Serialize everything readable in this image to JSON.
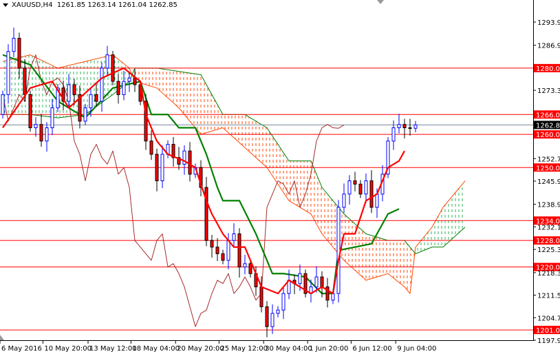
{
  "header": {
    "symbol": "XAUUSD,H4",
    "open": "1261.85",
    "high": "1263.14",
    "low": "1261.04",
    "close": "1262.85"
  },
  "colors": {
    "bull": "#0000ff",
    "bear": "#ff0000",
    "tenkan": "#ff0000",
    "kijun": "#008000",
    "chikou": "#a52a2a",
    "cloud_bull": "#2eb35a",
    "cloud_bear": "#ff4500",
    "level": "#ff0000",
    "current": "#778899"
  },
  "chart_data": {
    "type": "candlestick",
    "title": "XAUUSD,H4",
    "ylim": [
      1197.9,
      1293.9
    ],
    "price_ticks": [
      "1293.90",
      "1286.90",
      "1273.30",
      "1252.70",
      "1245.90",
      "1238.90",
      "1232.10",
      "1225.30",
      "1218.30",
      "1211.50",
      "1204.70",
      "1197.90"
    ],
    "levels": [
      "1280.00",
      "1266.00",
      "1260.00",
      "1250.00",
      "1234.00",
      "1228.00",
      "1220.00",
      "1201.00"
    ],
    "current_price": "1262.85",
    "time_labels": [
      {
        "label": "6 May 2016",
        "bar": -0.5
      },
      {
        "label": "10 May 20:00",
        "bar": 7.3
      },
      {
        "label": "13 May 12:00",
        "bar": 15.5
      },
      {
        "label": "18 May 04:00",
        "bar": 23.3
      },
      {
        "label": "20 May 20:00",
        "bar": 31.4
      },
      {
        "label": "25 May 12:00",
        "bar": 39.3
      },
      {
        "label": "30 May 04:00",
        "bar": 47.4
      },
      {
        "label": "1 Jun 20:00",
        "bar": 55.4
      },
      {
        "label": "6 Jun 12:00",
        "bar": 63.3
      },
      {
        "label": "9 Jun 04:00",
        "bar": 71.4
      }
    ],
    "close": [
      1272,
      1285,
      1289,
      1280,
      1272,
      1262,
      1263,
      1258,
      1262,
      1268,
      1274,
      1270,
      1275,
      1272,
      1264,
      1268,
      1272,
      1270,
      1280,
      1284,
      1276,
      1272,
      1276,
      1277,
      1275,
      1270,
      1258,
      1254,
      1246,
      1254,
      1257,
      1253,
      1251,
      1255,
      1248,
      1250,
      1244,
      1228,
      1226,
      1224,
      1222,
      1228,
      1230,
      1220,
      1221,
      1218,
      1214,
      1208,
      1202,
      1206,
      1207,
      1212,
      1216,
      1215,
      1218,
      1212,
      1214,
      1217,
      1214,
      1210,
      1212,
      1238,
      1242,
      1246,
      1245,
      1242,
      1246,
      1238,
      1242,
      1248,
      1258,
      1262,
      1263,
      1262,
      1261.85,
      1262.85
    ],
    "tenkan": [
      [
        0,
        1262
      ],
      [
        5,
        1274
      ],
      [
        9,
        1276
      ],
      [
        12,
        1268
      ],
      [
        18,
        1277
      ],
      [
        22,
        1280
      ],
      [
        25,
        1276
      ],
      [
        26,
        1266
      ],
      [
        28,
        1258
      ],
      [
        30,
        1254
      ],
      [
        33,
        1252
      ],
      [
        35,
        1250
      ],
      [
        37,
        1240
      ],
      [
        38,
        1236
      ],
      [
        40,
        1230
      ],
      [
        42,
        1226
      ],
      [
        44,
        1226
      ],
      [
        46,
        1218
      ],
      [
        47,
        1214
      ],
      [
        50,
        1212
      ],
      [
        52,
        1216
      ],
      [
        54,
        1214
      ],
      [
        56,
        1212
      ],
      [
        58,
        1214
      ],
      [
        60,
        1212
      ],
      [
        61,
        1222
      ],
      [
        62,
        1230
      ],
      [
        64,
        1230
      ],
      [
        66,
        1240
      ],
      [
        68,
        1242
      ],
      [
        70,
        1250
      ],
      [
        72,
        1252
      ],
      [
        73,
        1255
      ]
    ],
    "kijun": [
      [
        0,
        1284
      ],
      [
        5,
        1281
      ],
      [
        10,
        1270
      ],
      [
        15,
        1265
      ],
      [
        20,
        1274
      ],
      [
        25,
        1276
      ],
      [
        27,
        1266
      ],
      [
        30,
        1266
      ],
      [
        32,
        1262
      ],
      [
        35,
        1262
      ],
      [
        37,
        1254
      ],
      [
        39,
        1244
      ],
      [
        40,
        1240
      ],
      [
        43,
        1240
      ],
      [
        46,
        1230
      ],
      [
        49,
        1218
      ],
      [
        51,
        1218
      ],
      [
        55,
        1217
      ],
      [
        58,
        1212
      ],
      [
        60,
        1212
      ],
      [
        61,
        1225
      ],
      [
        67,
        1227
      ],
      [
        70,
        1236
      ],
      [
        72,
        1237.5
      ]
    ],
    "chikou_shift": 13,
    "cloud": [
      [
        0,
        1282,
        1266
      ],
      [
        5,
        1284,
        1266
      ],
      [
        10,
        1280,
        1265
      ],
      [
        15,
        1282,
        1266
      ],
      [
        20,
        1284,
        1272
      ],
      [
        23,
        1280,
        1276
      ],
      [
        24,
        1276,
        1280
      ],
      [
        28,
        1274,
        1280
      ],
      [
        32,
        1268,
        1279
      ],
      [
        36,
        1260,
        1278
      ],
      [
        40,
        1262,
        1266
      ],
      [
        44,
        1256,
        1266
      ],
      [
        48,
        1250,
        1262
      ],
      [
        52,
        1240,
        1252
      ],
      [
        56,
        1236,
        1252
      ],
      [
        58,
        1230,
        1244
      ],
      [
        62,
        1222,
        1236
      ],
      [
        66,
        1216,
        1230
      ],
      [
        70,
        1218,
        1228
      ],
      [
        73,
        1214,
        1228
      ],
      [
        74,
        1212,
        1226
      ],
      [
        75,
        1226,
        1224
      ],
      [
        78,
        1232,
        1226
      ],
      [
        80,
        1238,
        1226
      ],
      [
        84,
        1246,
        1232
      ]
    ]
  }
}
